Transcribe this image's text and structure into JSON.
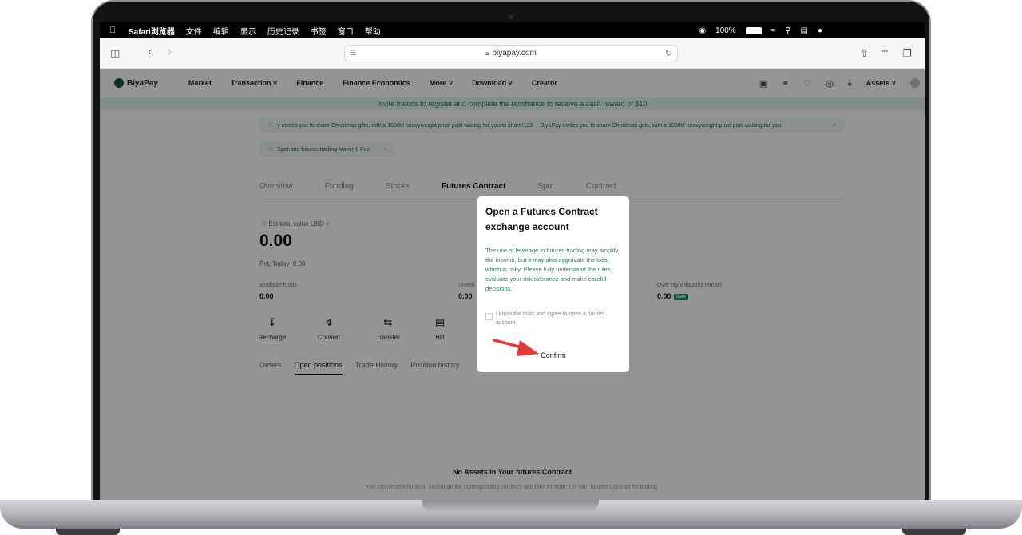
{
  "menubar": {
    "apple_icon": "apple-logo-icon",
    "items": [
      "Safari浏览器",
      "文件",
      "编辑",
      "显示",
      "历史记录",
      "书签",
      "窗口",
      "帮助"
    ],
    "battery_text": "100%"
  },
  "browser": {
    "url": "biyapay.com"
  },
  "site": {
    "logo_text": "BiyaPay",
    "nav": [
      "Market",
      "Transaction",
      "Finance",
      "Finance Economics",
      "More",
      "Download",
      "Creator"
    ],
    "assets_label": "Assets",
    "banner_text": "Invite friends to register and complete the remittance to receive a cash reward of $10",
    "notice1_text": "y invites you to share Christmas gifts, with a 1000U heavyweight prize pool waiting for you to share!123     BiyaPay invites you to share Christmas gifts, with a 1000U heavyweight prize pool waiting for you",
    "notice2_text": "Spot and futures trading Maker 0 Fee",
    "tabs": [
      "Overview",
      "Funding",
      "Stocks",
      "Futures Contract",
      "Spot",
      "Contract"
    ],
    "est_label": "Est total value",
    "currency": "USD",
    "total_value": "0.00",
    "pnl_label": "PnL Today",
    "pnl_value": "0.00",
    "available_label": "available funds",
    "available_value": "0.00",
    "unreal_label": "Unreal",
    "unreal_value": "0.00",
    "overnight_label": "Over night liquidity remain",
    "overnight_value": "0.00",
    "safe_badge": "Safe",
    "actions": [
      "Recharge",
      "Convert",
      "Transfer",
      "Bill"
    ],
    "subtabs": [
      "Orders",
      "Open positions",
      "Trade History",
      "Position history"
    ],
    "empty_title": "No Assets in Your futures Contract",
    "empty_sub": "You can deposit funds or exchange the corresponding currency and then transfer it to your futures Contract for trading."
  },
  "modal": {
    "title": "Open a Futures Contract exchange account",
    "description": "The use of leverage in futures trading may amplify the income, but it may also aggravate the loss, which is risky. Please fully understand the rules, evaluate your risk tolerance and make careful decisions.",
    "agree_text": "I know the risks and agree to open a futures account.",
    "confirm_label": "Confirm"
  },
  "colors": {
    "brand": "#0f5b3e",
    "accent_text": "#2f7a66",
    "arrow": "#e53935"
  }
}
